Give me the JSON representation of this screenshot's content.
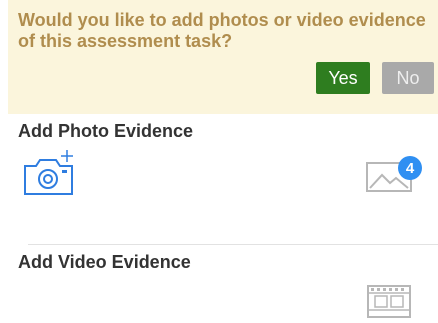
{
  "prompt": {
    "question": "Would you like to add photos or video evidence of this assessment task?",
    "yes_label": "Yes",
    "no_label": "No"
  },
  "photo_section": {
    "title": "Add Photo Evidence",
    "photo_count_badge": "4"
  },
  "video_section": {
    "title": "Add Video Evidence"
  },
  "colors": {
    "prompt_background": "#fbf5dc",
    "prompt_text": "#b08d4e",
    "yes_button": "#2e7d1f",
    "no_button": "#a9a9a9",
    "camera_icon": "#2f7de0",
    "badge": "#2f8ff2"
  },
  "icons": {
    "camera": "camera-plus-icon",
    "photo_gallery": "image-gallery-icon",
    "video_gallery": "film-strip-icon"
  }
}
